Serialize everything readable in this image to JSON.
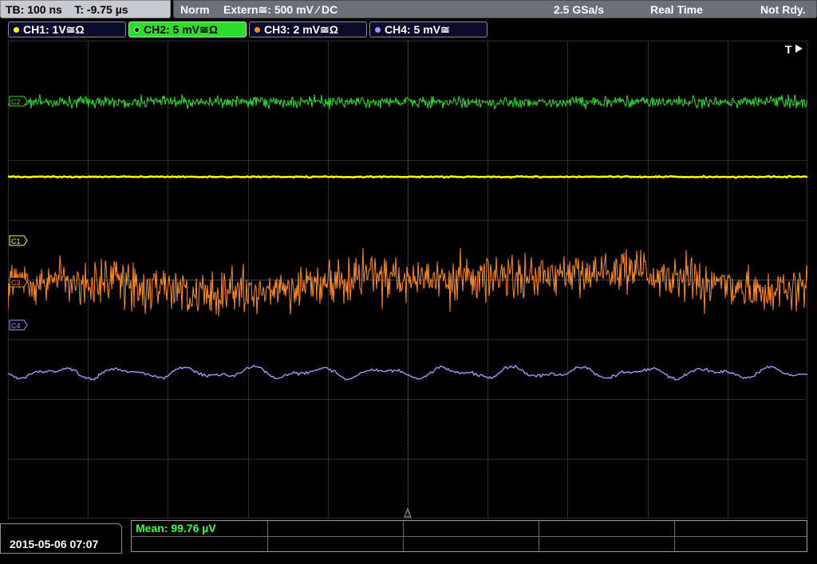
{
  "topbar": {
    "timebase": "TB: 100 ns",
    "trigger_time": "T: -9.75 µs",
    "mode": "Norm",
    "trigger_source": "Extern≅: 500 mV ⁄ DC",
    "sample_rate": "2.5 GSa/s",
    "acq_mode": "Real Time",
    "status": "Not Rdy."
  },
  "channels": [
    {
      "label": "CH1: 1V≅Ω",
      "color": "#ffff00"
    },
    {
      "label": "CH2: 5 mV≅Ω",
      "color": "#2ddc2d"
    },
    {
      "label": "CH3: 2 mV≅Ω",
      "color": "#ff8a2a"
    },
    {
      "label": "CH4: 5 mV≅",
      "color": "#9a9aff"
    }
  ],
  "markers": {
    "c1": "C1",
    "c2": "C2",
    "c3": "C3",
    "c4": "C4",
    "trigger": "T"
  },
  "footer": {
    "datetime": "2015-05-06 07:07",
    "measurement": "Mean: 99.76 µV"
  }
}
